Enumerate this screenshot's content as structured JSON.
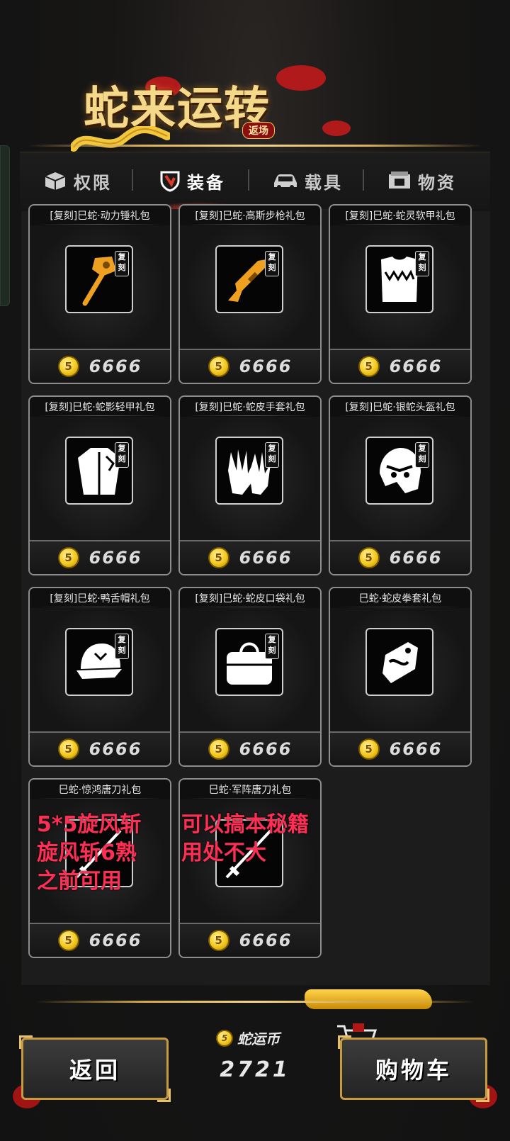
{
  "banner": {
    "title": "蛇来运转",
    "subtitle": "返场"
  },
  "tabs": [
    {
      "label": "权限",
      "icon": "box-icon",
      "active": false
    },
    {
      "label": "装备",
      "icon": "shield-icon",
      "active": true
    },
    {
      "label": "载具",
      "icon": "car-icon",
      "active": false
    },
    {
      "label": "物资",
      "icon": "crate-icon",
      "active": false
    }
  ],
  "items": [
    {
      "title": "[复刻]巳蛇·动力锤礼包",
      "price": "6666",
      "badge": "复刻",
      "icon": "hammer-icon",
      "accent": "#f0a020"
    },
    {
      "title": "[复刻]巳蛇·高斯步枪礼包",
      "price": "6666",
      "badge": "复刻",
      "icon": "rifle-icon",
      "accent": "#f0a020"
    },
    {
      "title": "[复刻]巳蛇·蛇灵软甲礼包",
      "price": "6666",
      "badge": "复刻",
      "icon": "vest-icon",
      "accent": "#ffffff"
    },
    {
      "title": "[复刻]巳蛇·蛇影轻甲礼包",
      "price": "6666",
      "badge": "复刻",
      "icon": "jacket-icon",
      "accent": "#ffffff"
    },
    {
      "title": "[复刻]巳蛇·蛇皮手套礼包",
      "price": "6666",
      "badge": "复刻",
      "icon": "gloves-icon",
      "accent": "#ffffff"
    },
    {
      "title": "[复刻]巳蛇·银蛇头盔礼包",
      "price": "6666",
      "badge": "复刻",
      "icon": "helmet-icon",
      "accent": "#ffffff"
    },
    {
      "title": "[复刻]巳蛇·鸭舌帽礼包",
      "price": "6666",
      "badge": "复刻",
      "icon": "cap-icon",
      "accent": "#ffffff"
    },
    {
      "title": "[复刻]巳蛇·蛇皮口袋礼包",
      "price": "6666",
      "badge": "复刻",
      "icon": "bag-icon",
      "accent": "#ffffff"
    },
    {
      "title": "巳蛇·蛇皮拳套礼包",
      "price": "6666",
      "badge": "",
      "icon": "fist-wrap-icon",
      "accent": "#ffffff"
    },
    {
      "title": "巳蛇·惊鸿唐刀礼包",
      "price": "6666",
      "badge": "",
      "icon": "blade-icon",
      "accent": "#ffffff"
    },
    {
      "title": "巳蛇·军阵唐刀礼包",
      "price": "6666",
      "badge": "",
      "icon": "blade-icon",
      "accent": "#ffffff"
    }
  ],
  "annotations": {
    "left": "5*5旋风斩\n旋风斩6熟\n之前可用",
    "right": "可以搞本秘籍\n用处不大"
  },
  "footer": {
    "back_label": "返回",
    "currency_label": "蛇运币",
    "currency_value": "2721",
    "cart_label": "购物车"
  },
  "coin_glyph": "5"
}
